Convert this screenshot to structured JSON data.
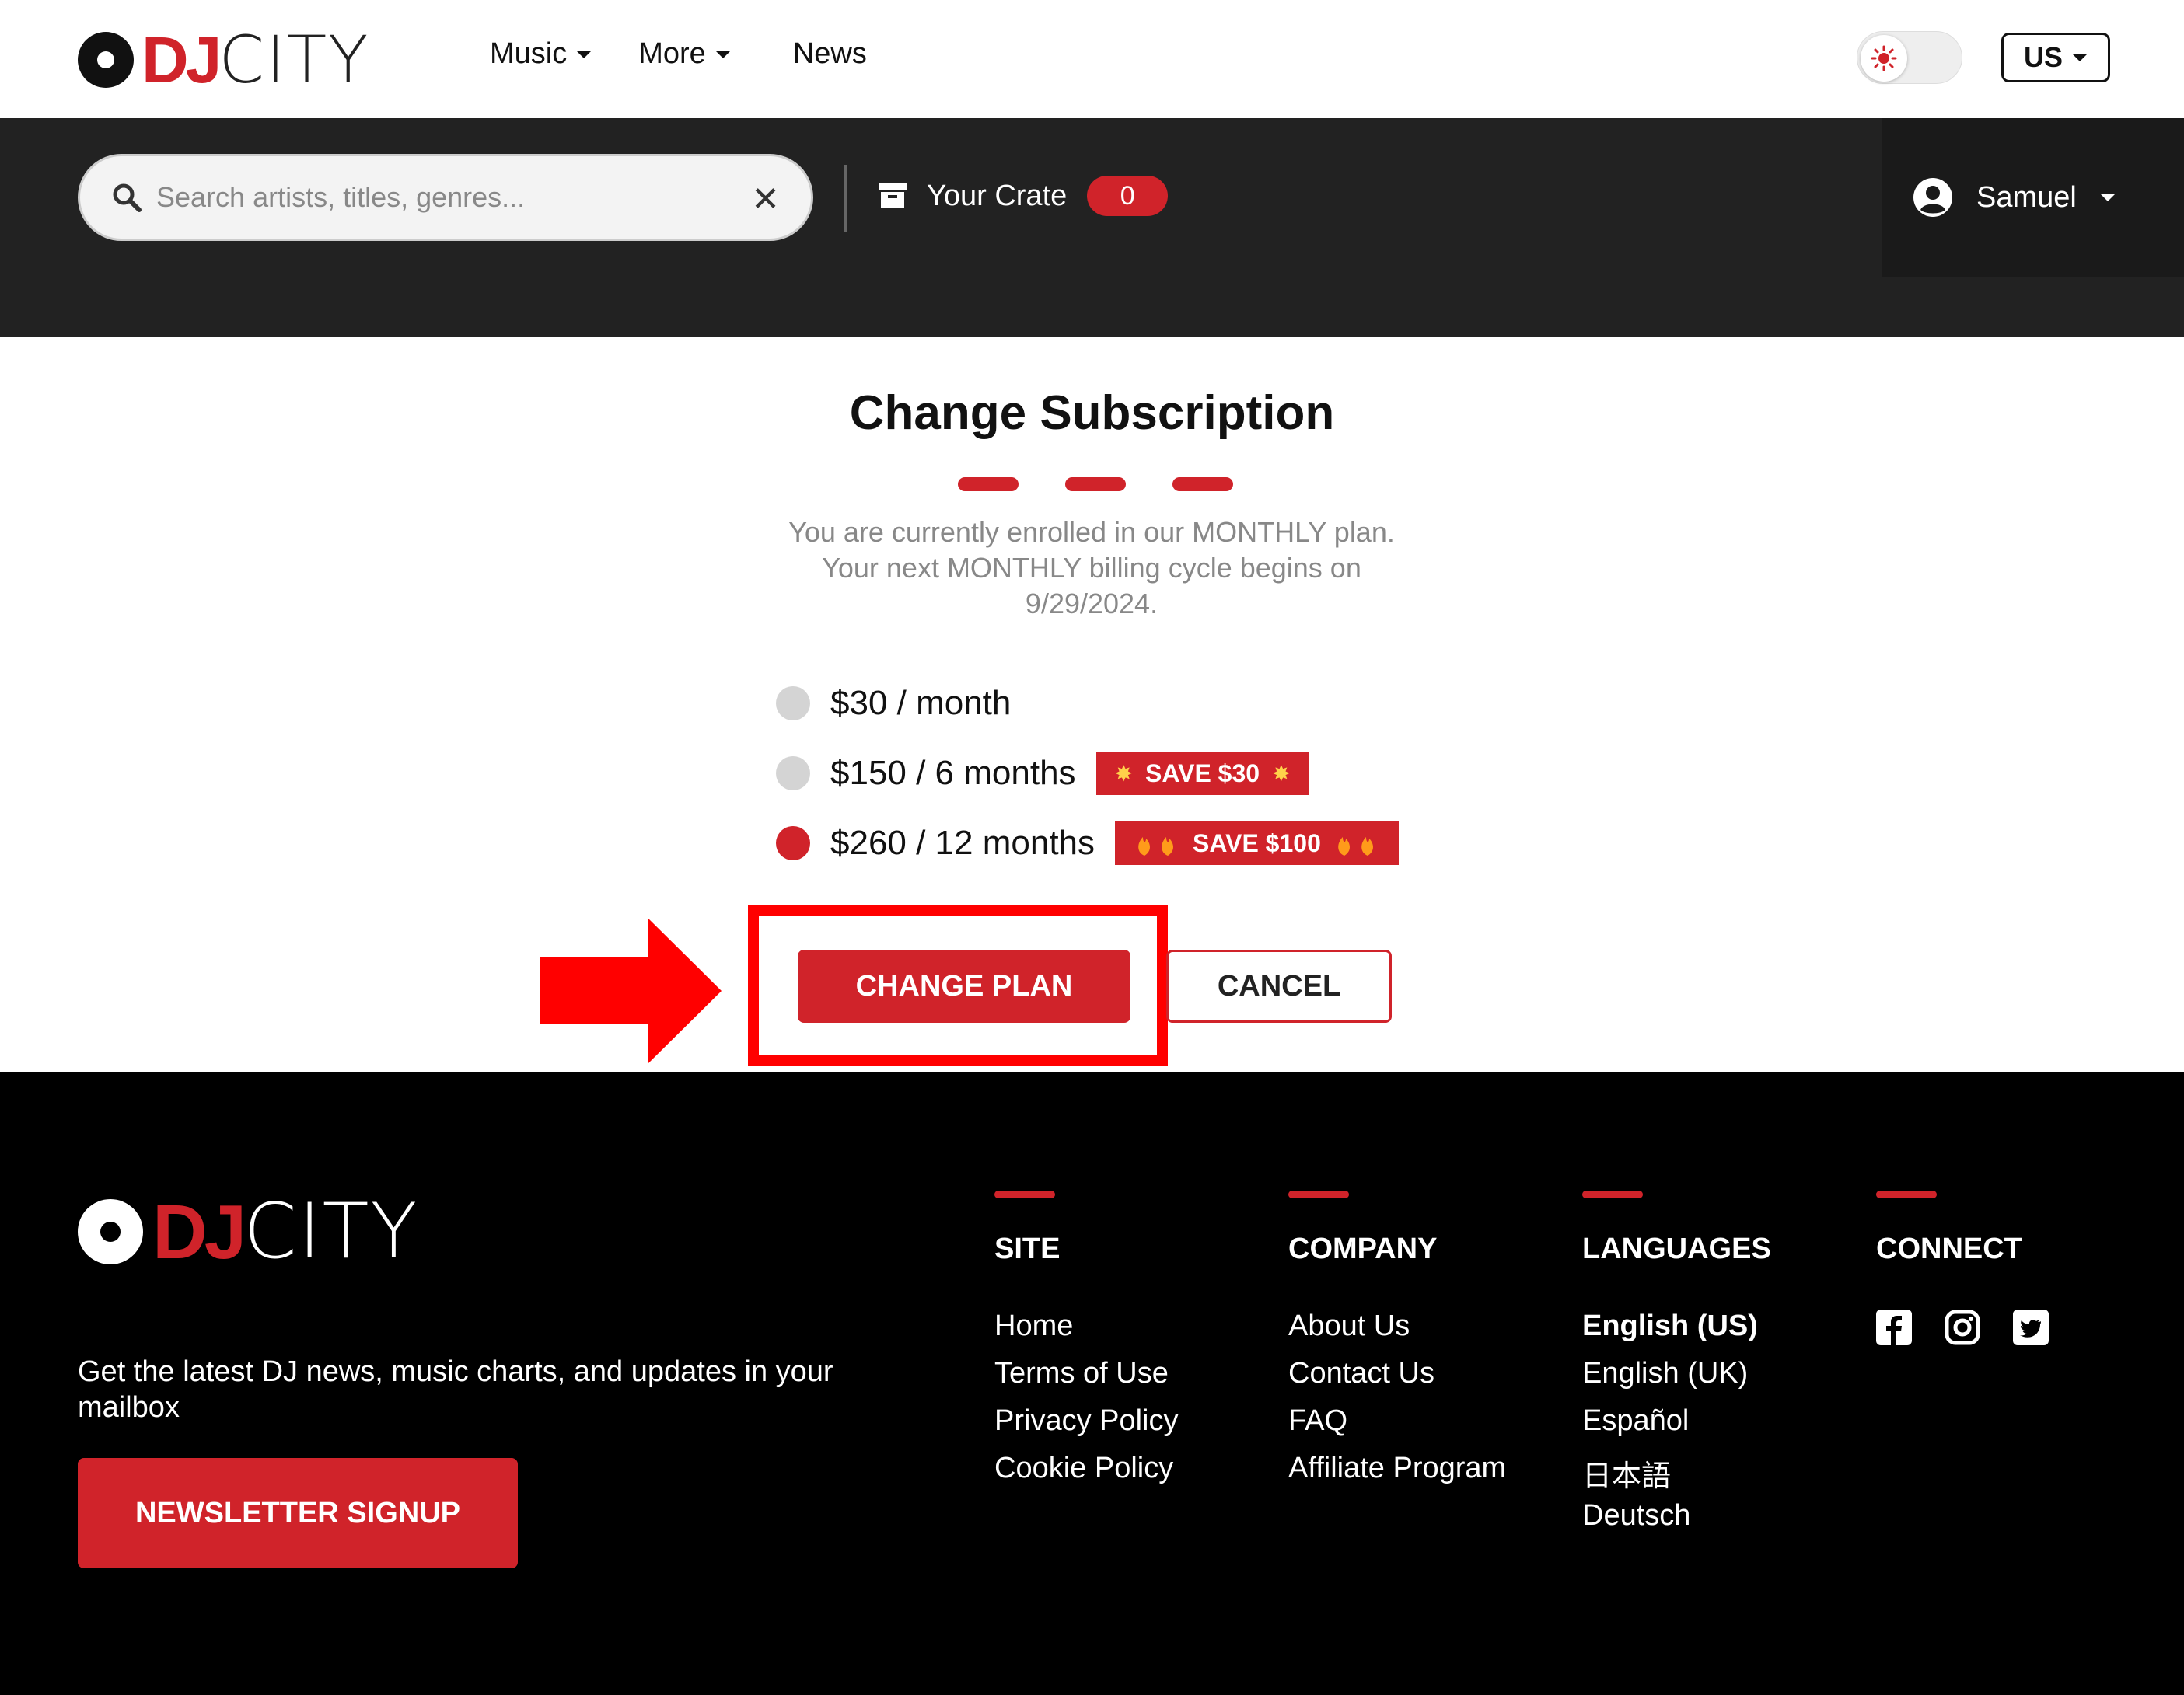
{
  "brand": {
    "logo_dj": "DJ",
    "logo_city": "CITY",
    "accent": "#d0232a"
  },
  "nav": {
    "items": [
      {
        "label": "Music",
        "has_dropdown": true
      },
      {
        "label": "More",
        "has_dropdown": true
      },
      {
        "label": "News",
        "has_dropdown": false
      }
    ],
    "region": "US",
    "theme_icon": "sun-icon"
  },
  "search": {
    "placeholder": "Search artists, titles, genres..."
  },
  "crate": {
    "label": "Your Crate",
    "count": "0"
  },
  "user": {
    "name": "Samuel"
  },
  "subscription": {
    "title": "Change Subscription",
    "enroll_line1": "You are currently enrolled in our MONTHLY plan.",
    "enroll_line2": "Your next MONTHLY billing cycle begins on",
    "enroll_date": "9/29/2024.",
    "plans": [
      {
        "label": "$30 / month",
        "badge": "",
        "selected": false
      },
      {
        "label": "$150 / 6 months",
        "badge": "SAVE $30",
        "selected": false
      },
      {
        "label": "$260 / 12 months",
        "badge": "SAVE $100",
        "selected": true
      }
    ],
    "change_label": "CHANGE PLAN",
    "cancel_label": "CANCEL"
  },
  "footer": {
    "tagline": "Get the latest DJ news, music charts, and updates in your mailbox",
    "newsletter_label": "NEWSLETTER SIGNUP",
    "site": {
      "heading": "SITE",
      "links": [
        "Home",
        "Terms of Use",
        "Privacy Policy",
        "Cookie Policy"
      ]
    },
    "company": {
      "heading": "COMPANY",
      "links": [
        "About Us",
        "Contact Us",
        "FAQ",
        "Affiliate Program"
      ]
    },
    "languages": {
      "heading": "LANGUAGES",
      "links": [
        "English (US)",
        "English (UK)",
        "Español",
        "日本語",
        "Deutsch"
      ]
    },
    "connect": {
      "heading": "CONNECT",
      "icons": [
        "facebook-icon",
        "instagram-icon",
        "twitter-icon"
      ]
    }
  }
}
